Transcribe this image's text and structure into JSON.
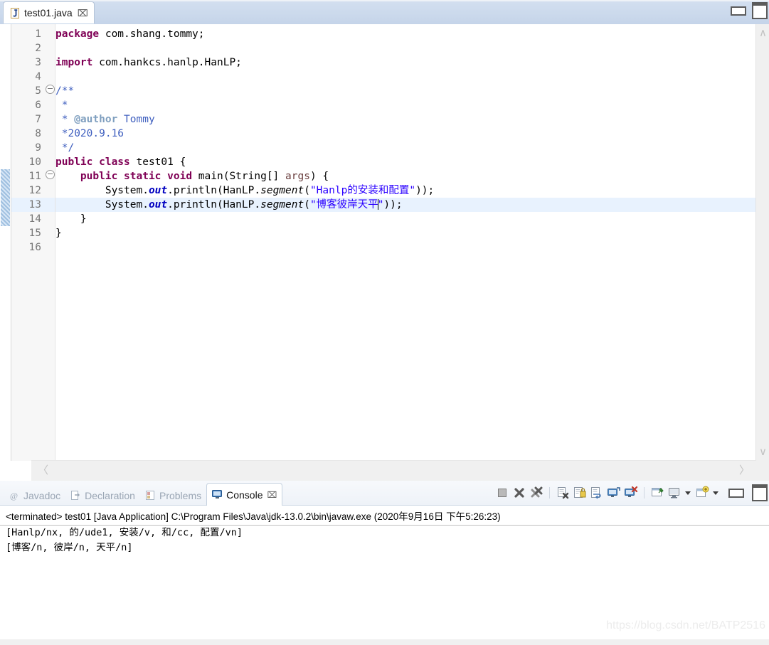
{
  "editor": {
    "tab": {
      "label": "test01.java",
      "icon": "java-file-icon",
      "close": "⌧"
    },
    "window_buttons": {
      "minimize": "minimize-icon",
      "maximize": "maximize-icon"
    },
    "lines": [
      {
        "num": "1",
        "fold": "",
        "changed": false,
        "highlight": false,
        "tokens": [
          {
            "t": "package",
            "c": "kw"
          },
          {
            "t": " com.shang.tommy;",
            "c": ""
          }
        ]
      },
      {
        "num": "2",
        "fold": "",
        "changed": false,
        "highlight": false,
        "tokens": []
      },
      {
        "num": "3",
        "fold": "",
        "changed": false,
        "highlight": false,
        "tokens": [
          {
            "t": "import",
            "c": "kw"
          },
          {
            "t": " com.hankcs.hanlp.HanLP;",
            "c": ""
          }
        ]
      },
      {
        "num": "4",
        "fold": "",
        "changed": false,
        "highlight": false,
        "tokens": []
      },
      {
        "num": "5",
        "fold": "⊖",
        "changed": false,
        "highlight": false,
        "tokens": [
          {
            "t": "/**",
            "c": "cmt"
          }
        ]
      },
      {
        "num": "6",
        "fold": "",
        "changed": false,
        "highlight": false,
        "tokens": [
          {
            "t": " *",
            "c": "cmt"
          }
        ]
      },
      {
        "num": "7",
        "fold": "",
        "changed": false,
        "highlight": false,
        "tokens": [
          {
            "t": " * ",
            "c": "cmt"
          },
          {
            "t": "@author",
            "c": "javadoc-tag"
          },
          {
            "t": " Tommy",
            "c": "cmt"
          }
        ]
      },
      {
        "num": "8",
        "fold": "",
        "changed": false,
        "highlight": false,
        "tokens": [
          {
            "t": " *2020.9.16",
            "c": "cmt"
          }
        ]
      },
      {
        "num": "9",
        "fold": "",
        "changed": false,
        "highlight": false,
        "tokens": [
          {
            "t": " */",
            "c": "cmt"
          }
        ]
      },
      {
        "num": "10",
        "fold": "",
        "changed": false,
        "highlight": false,
        "tokens": [
          {
            "t": "public class",
            "c": "kw"
          },
          {
            "t": " test01 {",
            "c": ""
          }
        ]
      },
      {
        "num": "11",
        "fold": "⊖",
        "changed": true,
        "highlight": false,
        "tokens": [
          {
            "t": "    ",
            "c": ""
          },
          {
            "t": "public static void",
            "c": "kw"
          },
          {
            "t": " main(String[] ",
            "c": ""
          },
          {
            "t": "args",
            "c": "param"
          },
          {
            "t": ") {",
            "c": ""
          }
        ]
      },
      {
        "num": "12",
        "fold": "",
        "changed": true,
        "highlight": false,
        "tokens": [
          {
            "t": "        System.",
            "c": ""
          },
          {
            "t": "out",
            "c": "stfield"
          },
          {
            "t": ".println(HanLP.",
            "c": ""
          },
          {
            "t": "segment",
            "c": "mth"
          },
          {
            "t": "(",
            "c": ""
          },
          {
            "t": "\"Hanlp的安装和配置\"",
            "c": "str"
          },
          {
            "t": "));",
            "c": ""
          }
        ]
      },
      {
        "num": "13",
        "fold": "",
        "changed": true,
        "highlight": true,
        "tokens": [
          {
            "t": "        System.",
            "c": ""
          },
          {
            "t": "out",
            "c": "stfield"
          },
          {
            "t": ".println(HanLP.",
            "c": ""
          },
          {
            "t": "segment",
            "c": "mth"
          },
          {
            "t": "(",
            "c": ""
          },
          {
            "t": "\"博客彼岸天平",
            "c": "str"
          },
          {
            "t": "|caret|",
            "c": "caret"
          },
          {
            "t": "\"",
            "c": "str"
          },
          {
            "t": "));",
            "c": ""
          }
        ]
      },
      {
        "num": "14",
        "fold": "",
        "changed": true,
        "highlight": false,
        "tokens": [
          {
            "t": "    }",
            "c": ""
          }
        ]
      },
      {
        "num": "15",
        "fold": "",
        "changed": false,
        "highlight": false,
        "tokens": [
          {
            "t": "}",
            "c": ""
          }
        ]
      },
      {
        "num": "16",
        "fold": "",
        "changed": false,
        "highlight": false,
        "tokens": []
      }
    ],
    "scrollbars": {
      "v_up": "∧",
      "v_down": "∨",
      "h_left": "〈",
      "h_right": "〉"
    }
  },
  "console": {
    "tabs": [
      {
        "label": "Javadoc",
        "icon": "javadoc-icon",
        "active": false,
        "close": ""
      },
      {
        "label": "Declaration",
        "icon": "declaration-icon",
        "active": false,
        "close": ""
      },
      {
        "label": "Problems",
        "icon": "problems-icon",
        "active": false,
        "close": ""
      },
      {
        "label": "Console",
        "icon": "console-icon",
        "active": true,
        "close": "⌧"
      }
    ],
    "toolbar": [
      {
        "name": "stop-button",
        "kind": "icon"
      },
      {
        "name": "terminate-button",
        "kind": "icon"
      },
      {
        "name": "remove-all-terminated-button",
        "kind": "icon"
      },
      {
        "name": "separator-1",
        "kind": "sep"
      },
      {
        "name": "clear-console-button",
        "kind": "icon"
      },
      {
        "name": "scroll-lock-button",
        "kind": "icon"
      },
      {
        "name": "word-wrap-button",
        "kind": "icon"
      },
      {
        "name": "show-console-on-output-button",
        "kind": "icon"
      },
      {
        "name": "show-console-on-error-button",
        "kind": "icon"
      },
      {
        "name": "separator-2",
        "kind": "sep"
      },
      {
        "name": "pin-console-button",
        "kind": "icon"
      },
      {
        "name": "display-console-button",
        "kind": "icon"
      },
      {
        "name": "display-console-dropdown",
        "kind": "caret"
      },
      {
        "name": "open-console-button",
        "kind": "icon"
      },
      {
        "name": "open-console-dropdown",
        "kind": "caret"
      },
      {
        "name": "minimize-view-button",
        "kind": "min"
      },
      {
        "name": "maximize-view-button",
        "kind": "max"
      }
    ],
    "terminated_line": "<terminated> test01 [Java Application] C:\\Program Files\\Java\\jdk-13.0.2\\bin\\javaw.exe (2020年9月16日 下午5:26:23)",
    "output_lines": [
      "[Hanlp/nx, 的/ude1, 安装/v, 和/cc, 配置/vn]",
      "[博客/n, 彼岸/n, 天平/n]"
    ],
    "watermark": "https://blog.csdn.net/BATP2516"
  }
}
